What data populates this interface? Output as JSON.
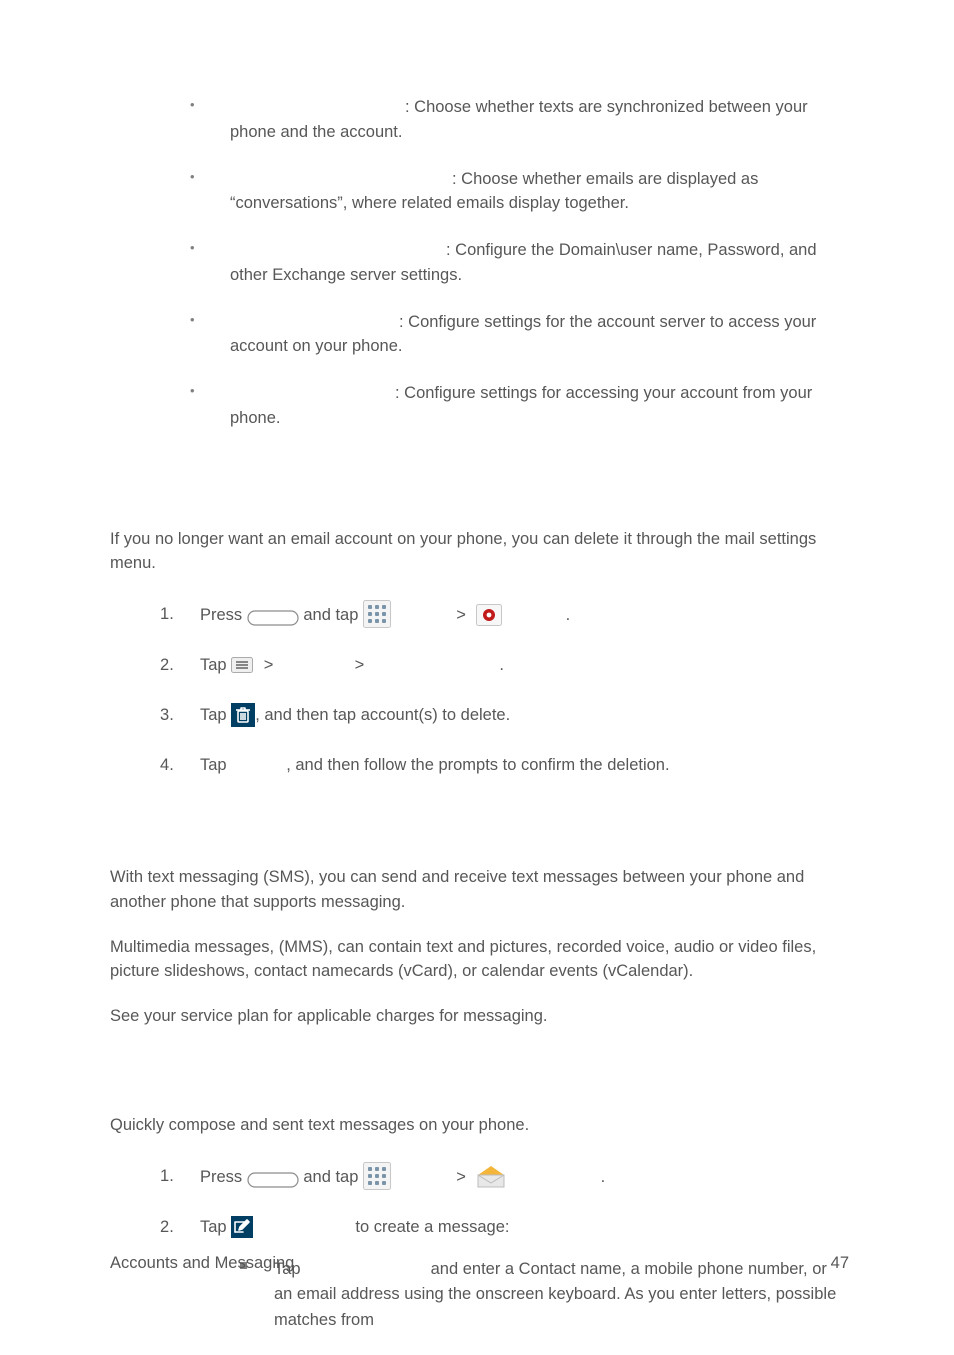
{
  "settings_bullets": [
    {
      "desc_prefix_w": 175,
      "desc": ": Choose whether texts are synchronized between your phone and the account."
    },
    {
      "desc_prefix_w": 222,
      "desc": ": Choose whether emails are displayed as “conversations”, where related emails display together."
    },
    {
      "desc_prefix_w": 216,
      "desc": ": Configure the Domain\\user name, Password, and other Exchange server settings."
    },
    {
      "desc_prefix_w": 169,
      "desc": ": Configure settings for the account server to access your account on your phone."
    },
    {
      "desc_prefix_w": 165,
      "desc": ": Configure settings for accessing your account from your phone."
    }
  ],
  "delete_intro": "If you no longer want an email account on your phone, you can delete it through the mail settings menu.",
  "delete_steps": {
    "s1": {
      "press": "Press ",
      "and_tap": " and tap "
    },
    "s2": {
      "tap": "Tap "
    },
    "s3": {
      "tap": "Tap ",
      "rest": ", and then tap account(s) to delete."
    },
    "s4": {
      "tap": "Tap ",
      "gap_w": 55,
      "rest": ", and then follow the prompts to confirm the deletion."
    }
  },
  "msg_para_1": "With text messaging (SMS), you can send and receive text messages between your phone and another phone that supports messaging.",
  "msg_para_2": "Multimedia messages, (MMS), can contain text and pictures, recorded voice, audio or video files, picture slideshows, contact namecards (vCard), or calendar events (vCalendar).",
  "msg_para_3": "See your service plan for applicable charges for messaging.",
  "compose_intro": "Quickly compose and sent text messages on your phone.",
  "compose_steps": {
    "s1": {
      "press": "Press ",
      "and_tap": " and tap "
    },
    "s2": {
      "tap": "Tap ",
      "gap_w": 93,
      "rest": " to create a message:"
    },
    "sub1": {
      "tap": "Tap",
      "gap_w": 130,
      "rest": "and enter a Contact name, a mobile phone number, or an email address using the onscreen keyboard. As you enter letters, possible matches from"
    }
  },
  "footer": {
    "left": "Accounts and Messaging",
    "right": "47"
  },
  "colors": {
    "text": "#575757",
    "bullet": "#808080",
    "icon_trash_bg": "#003E63",
    "icon_compose_bg": "#003E63",
    "icon_settings_dot": "#C11A1A",
    "icon_env_top": "#F3B63A",
    "icon_env_body": "#E8E8E8"
  }
}
